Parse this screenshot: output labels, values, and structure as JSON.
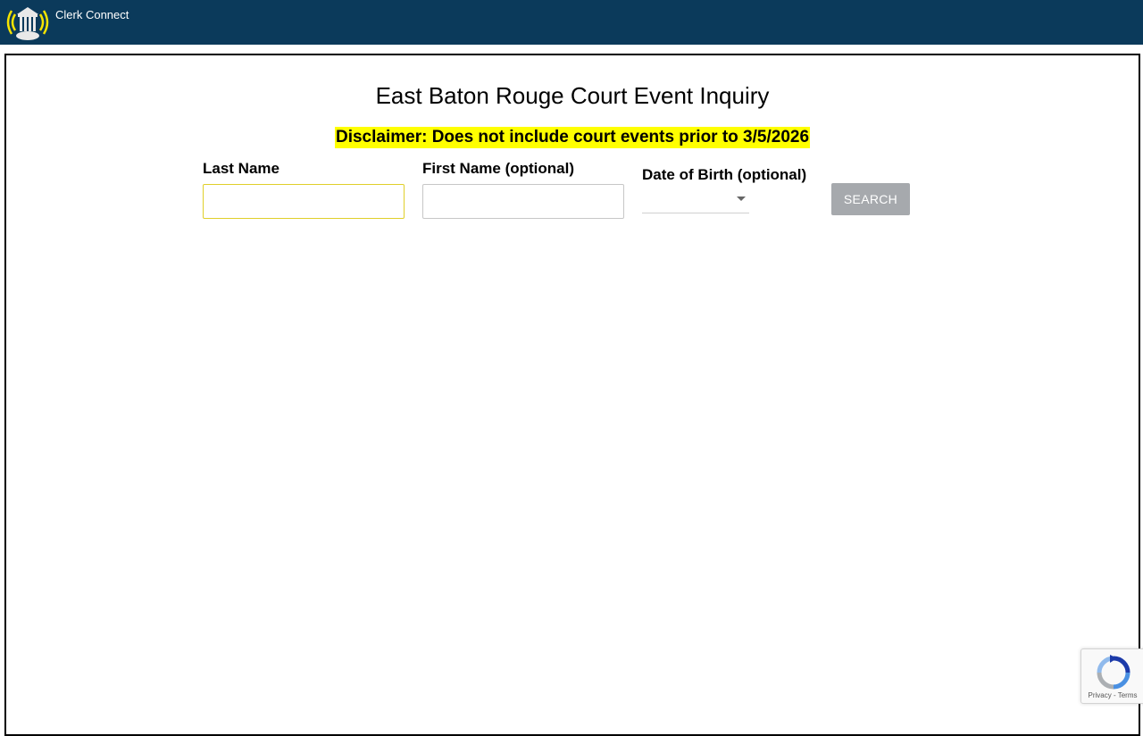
{
  "app": {
    "title": "Clerk Connect",
    "logo_icon": "courthouse-signal-icon"
  },
  "page": {
    "title": "East Baton Rouge Court Event Inquiry",
    "disclaimer": "Disclaimer: Does not include court events prior to 3/5/2026"
  },
  "form": {
    "last_name_label": "Last Name",
    "last_name_value": "",
    "first_name_label": "First Name (optional)",
    "first_name_value": "",
    "dob_label": "Date of Birth (optional)",
    "dob_value": "",
    "search_label": "SEARCH"
  },
  "recaptcha": {
    "privacy": "Privacy",
    "separator": " - ",
    "terms": "Terms"
  },
  "colors": {
    "header_bg": "#0b3a5b",
    "disclaimer_bg": "#ffff00",
    "focus_border": "#e0cf2a",
    "button_bg": "#a6a9ad"
  }
}
